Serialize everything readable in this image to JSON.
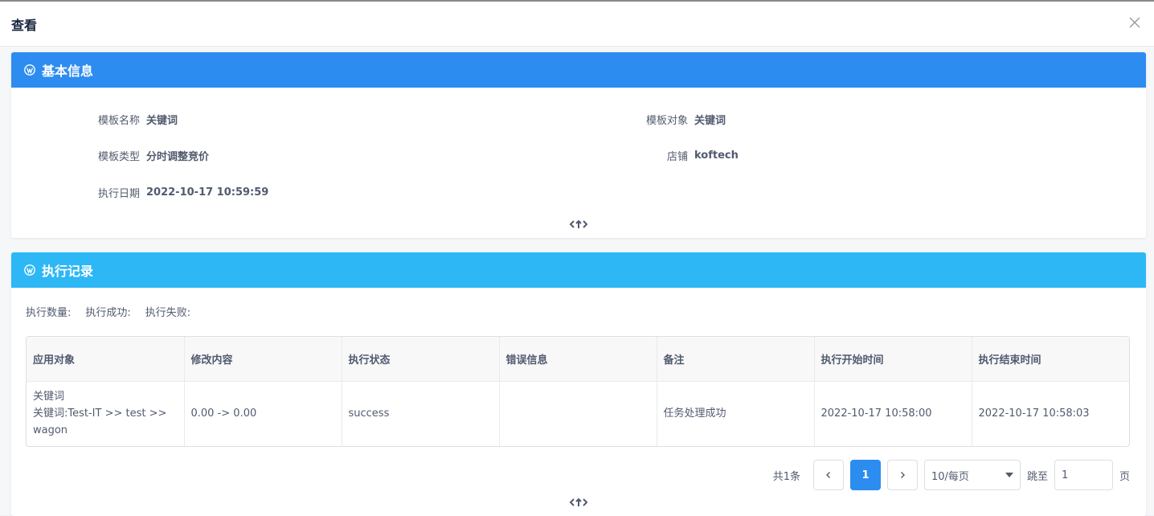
{
  "modal": {
    "title": "查看"
  },
  "basic_info": {
    "title": "基本信息",
    "fields": {
      "template_name": {
        "label": "模板名称",
        "value": "关键词"
      },
      "template_target": {
        "label": "模板对象",
        "value": "关键词"
      },
      "template_type": {
        "label": "模板类型",
        "value": "分时调整竞价"
      },
      "shop": {
        "label": "店铺",
        "value": "koftech"
      },
      "exec_date": {
        "label": "执行日期",
        "value": "2022-10-17 10:59:59"
      }
    }
  },
  "exec_records": {
    "title": "执行记录",
    "stats": {
      "count": "执行数量:",
      "success": "执行成功:",
      "fail": "执行失败:"
    },
    "columns": [
      "应用对象",
      "修改内容",
      "执行状态",
      "错误信息",
      "备注",
      "执行开始时间",
      "执行结束时间"
    ],
    "rows": [
      {
        "target_line1": "关键词",
        "target_line2": "关键词:Test-IT >> test >> wagon",
        "change": "0.00 -> 0.00",
        "status": "success",
        "error": "",
        "remark": "任务处理成功",
        "start": "2022-10-17 10:58:00",
        "end": "2022-10-17 10:58:03"
      }
    ]
  },
  "pagination": {
    "total": "共1条",
    "current_page": "1",
    "page_size": "10/每页",
    "jump_label": "跳至",
    "jump_value": "1",
    "page_suffix": "页"
  },
  "colors": {
    "primary": "#2d8cf0",
    "info": "#2db7f5"
  }
}
